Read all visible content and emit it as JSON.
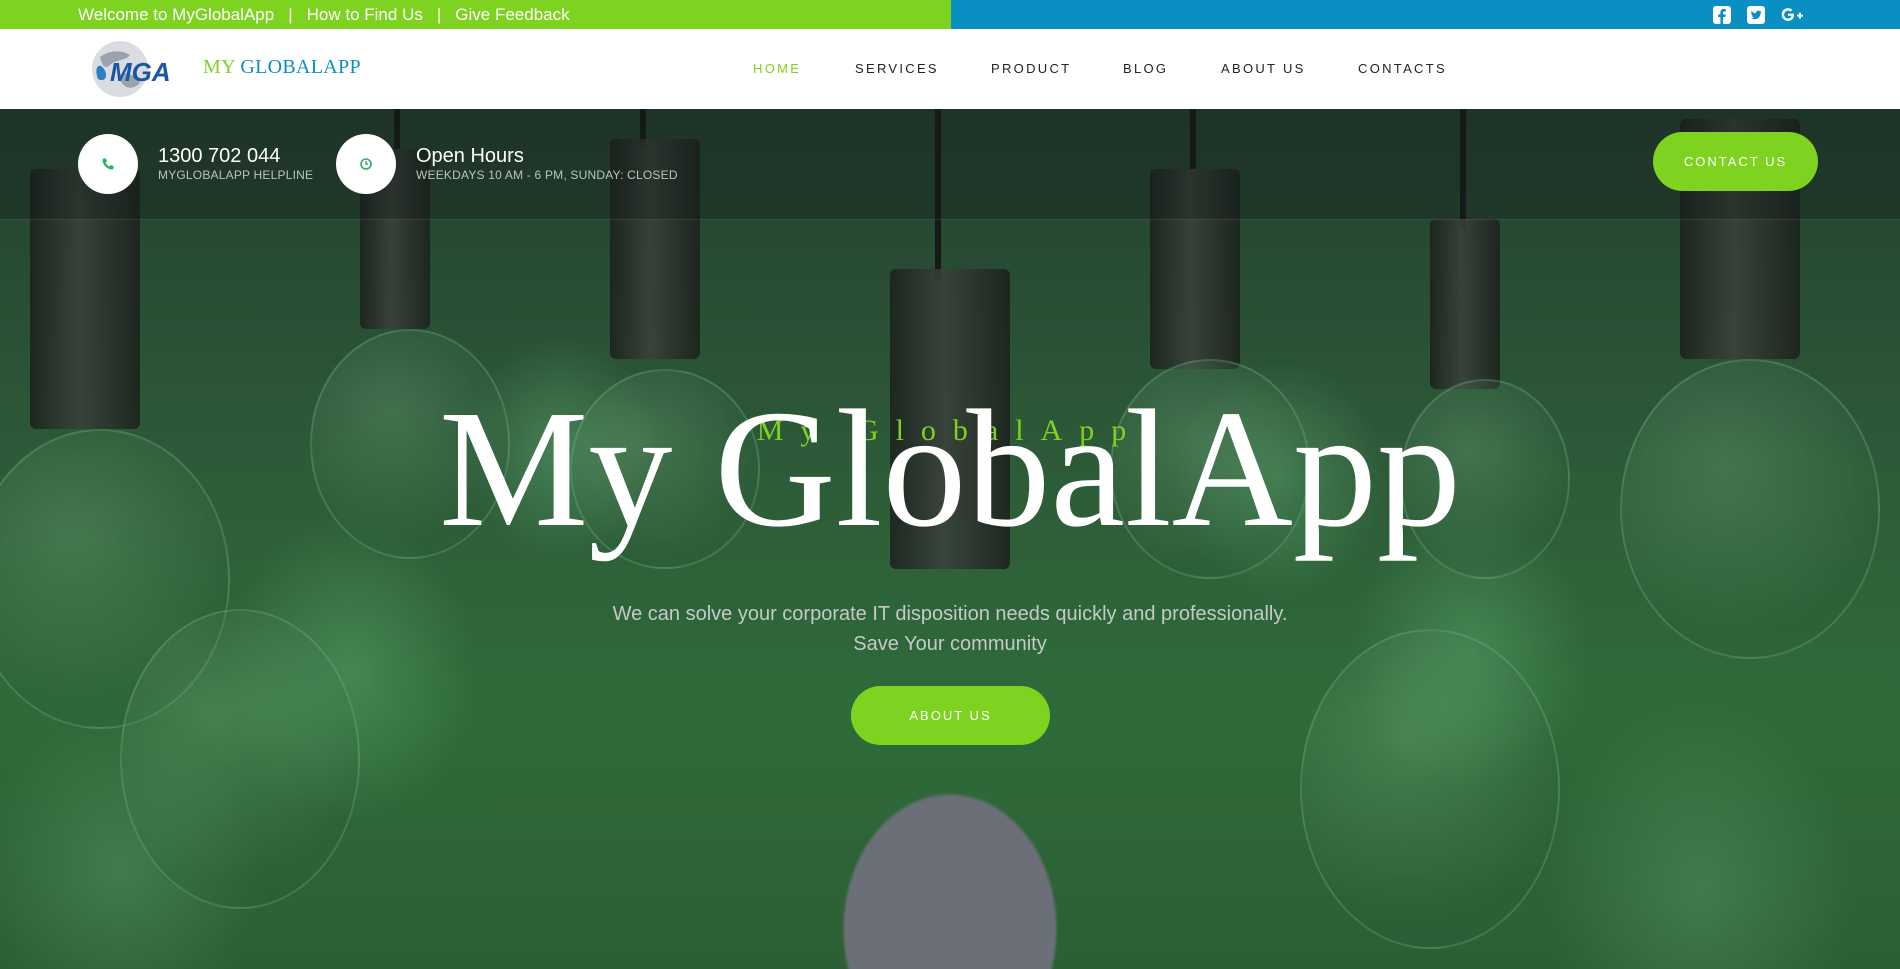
{
  "topbar": {
    "welcome": "Welcome to MyGlobalApp",
    "sep": "|",
    "find_us": "How to Find Us",
    "feedback": "Give Feedback",
    "social": [
      "facebook-icon",
      "twitter-icon",
      "google-plus-icon"
    ],
    "colors": {
      "left": "#7ed321",
      "right": "#0a8fc2"
    }
  },
  "header": {
    "logo_text": "MGA",
    "brand_my": "MY",
    "brand_rest": "GLOBALAPP",
    "nav": [
      "HOME",
      "SERVICES",
      "PRODUCT",
      "BLOG",
      "ABOUT US",
      "CONTACTS"
    ],
    "active": "HOME"
  },
  "info": {
    "phone": {
      "icon": "phone-icon",
      "title": "1300 702 044",
      "sub": "MYGLOBALAPP HELPLINE"
    },
    "hours": {
      "icon": "clock-icon",
      "title": "Open Hours",
      "sub": "WEEKDAYS 10 AM - 6 PM, SUNDAY: CLOSED"
    },
    "contact_button": "CONTACT US"
  },
  "hero": {
    "small": "My GlobalApp",
    "big": "My GlobalApp",
    "line1": "We can solve your corporate IT disposition needs quickly and professionally.",
    "line2": "Save Your community",
    "button": "ABOUT US"
  },
  "accent": "#7ed321"
}
